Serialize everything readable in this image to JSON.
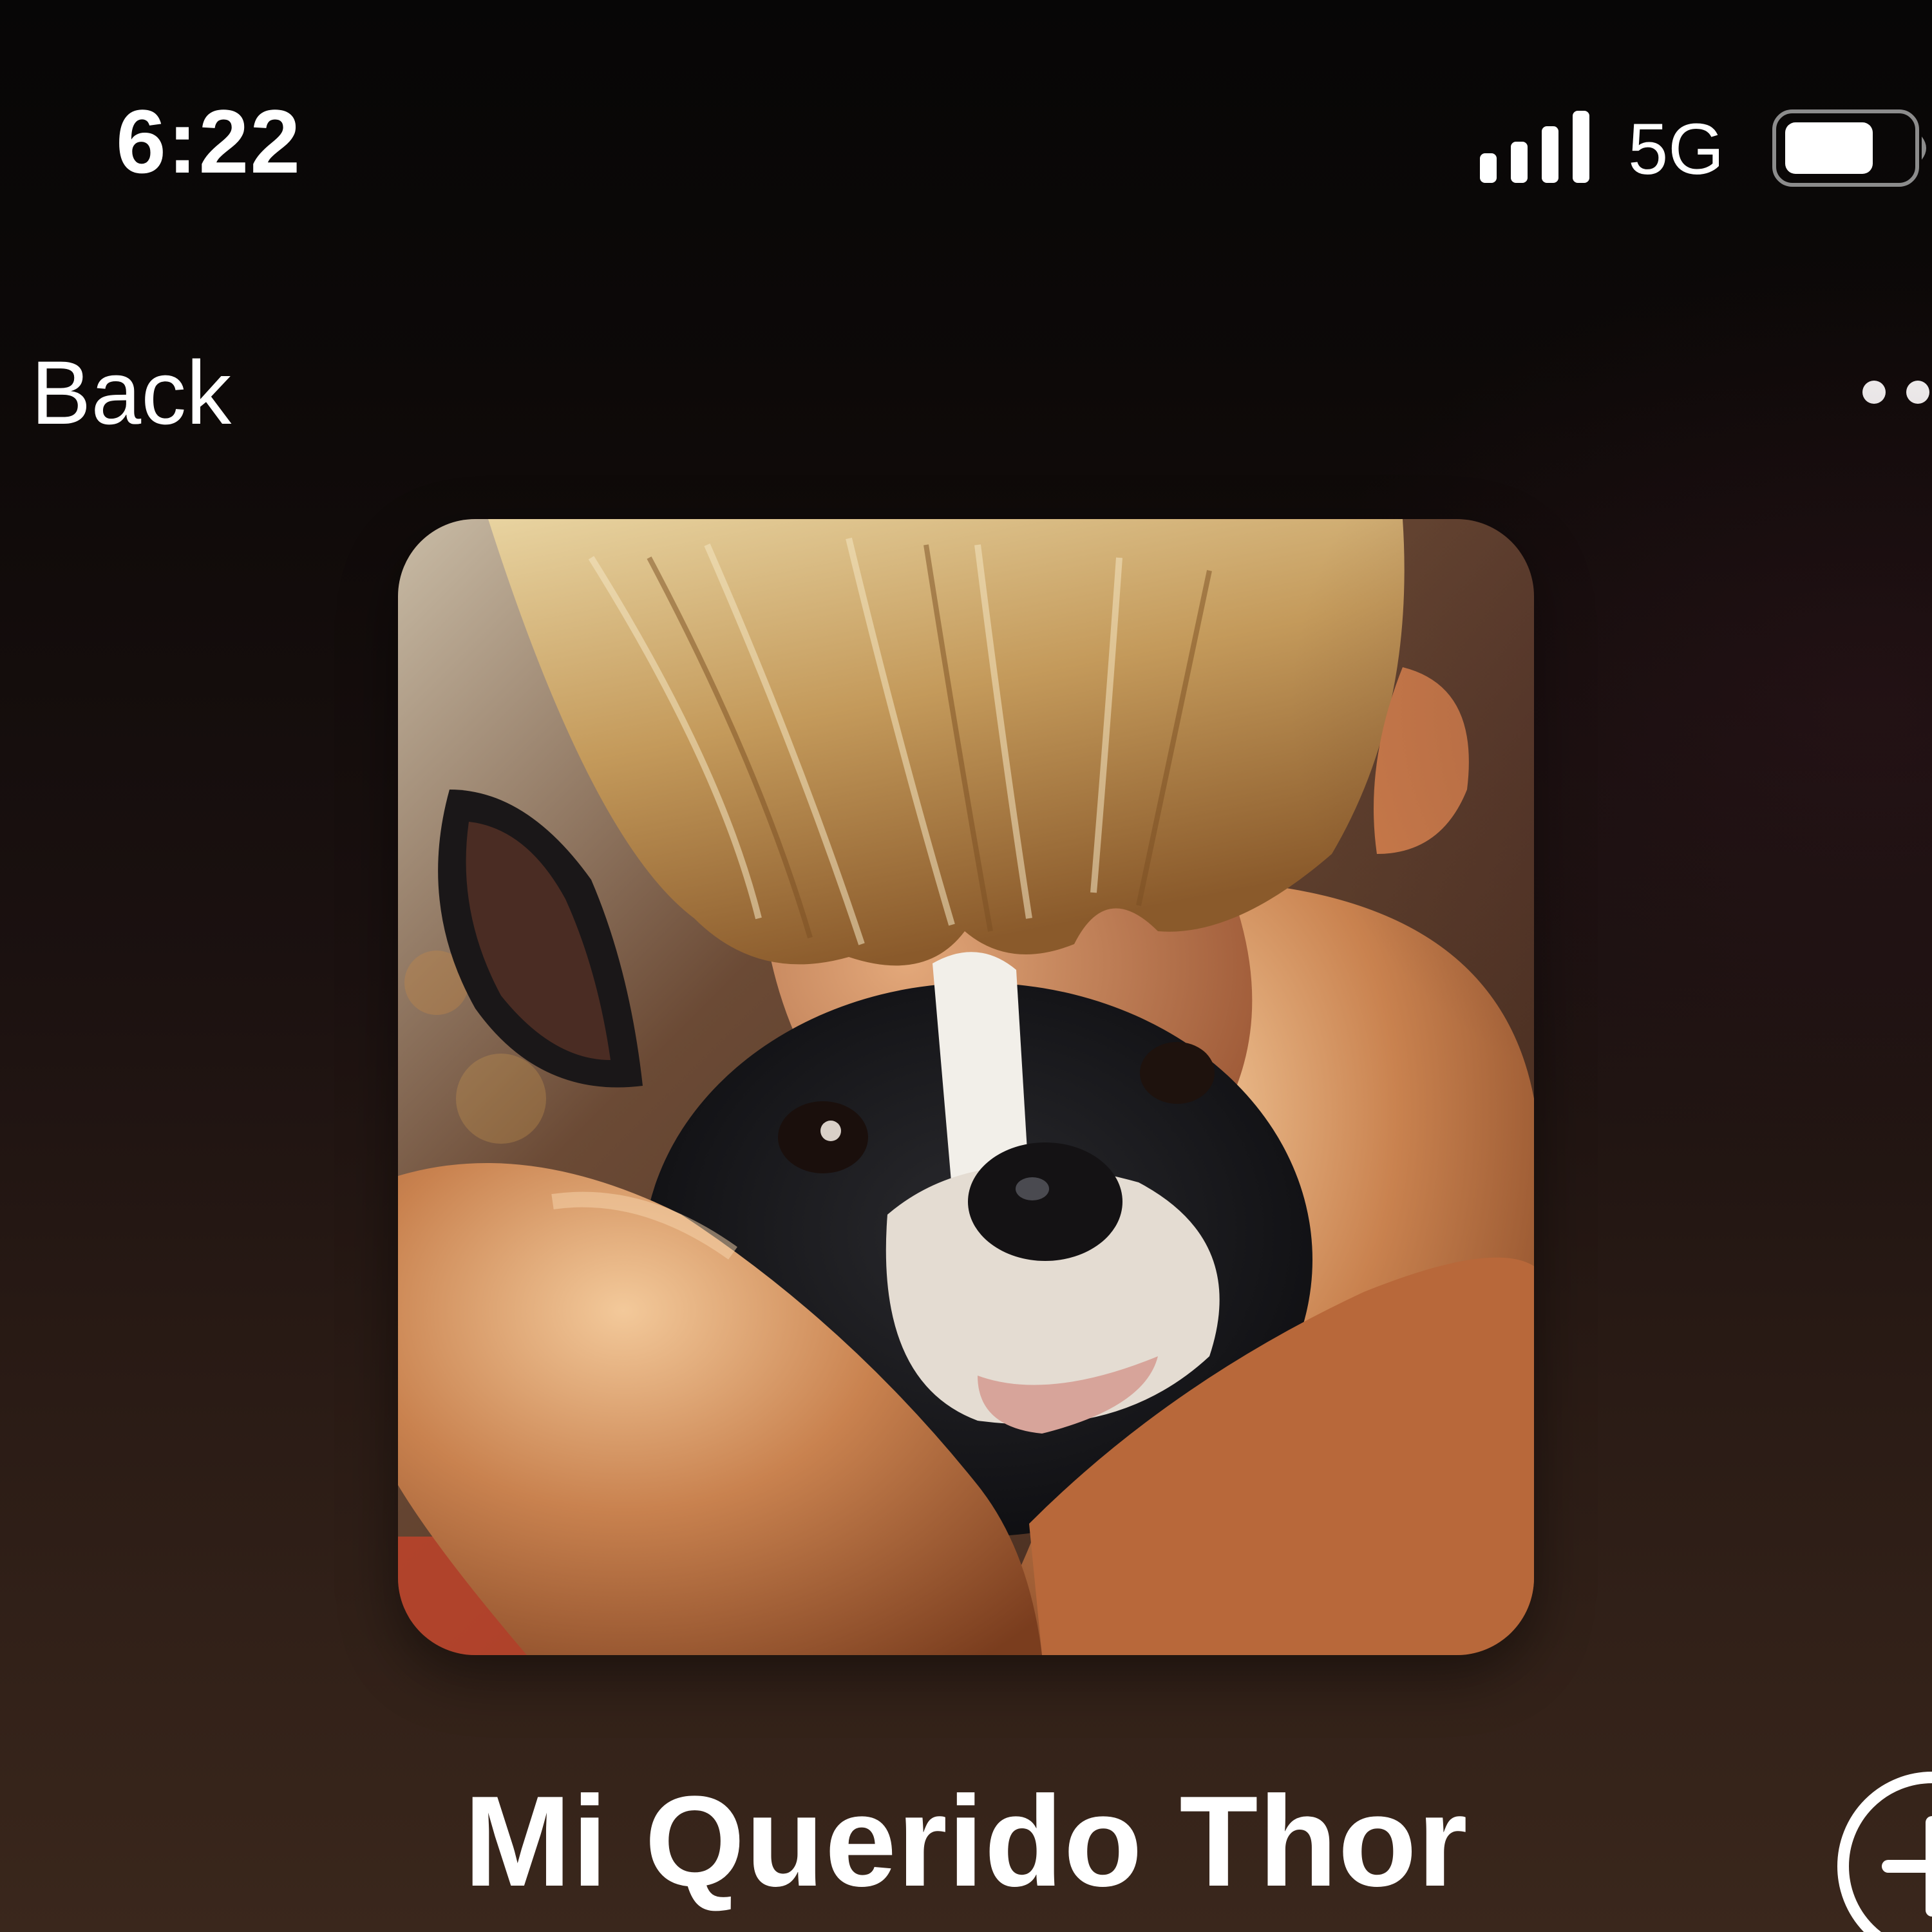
{
  "status_bar": {
    "time": "6:22",
    "network": "5G",
    "signal_bars": 4,
    "battery_level": 0.7,
    "icons": [
      "signal-icon",
      "battery-icon"
    ]
  },
  "nav": {
    "back_label": "Back",
    "more_icon": "ellipsis-icon"
  },
  "playlist": {
    "title": "Mi Querido Thor",
    "cover_art": "photo: blond child hugging black-and-white dog",
    "add_icon": "plus-circle-icon"
  },
  "colors": {
    "text": "#ffffff",
    "background_top": "#070606",
    "background_bottom": "#3a271c"
  }
}
